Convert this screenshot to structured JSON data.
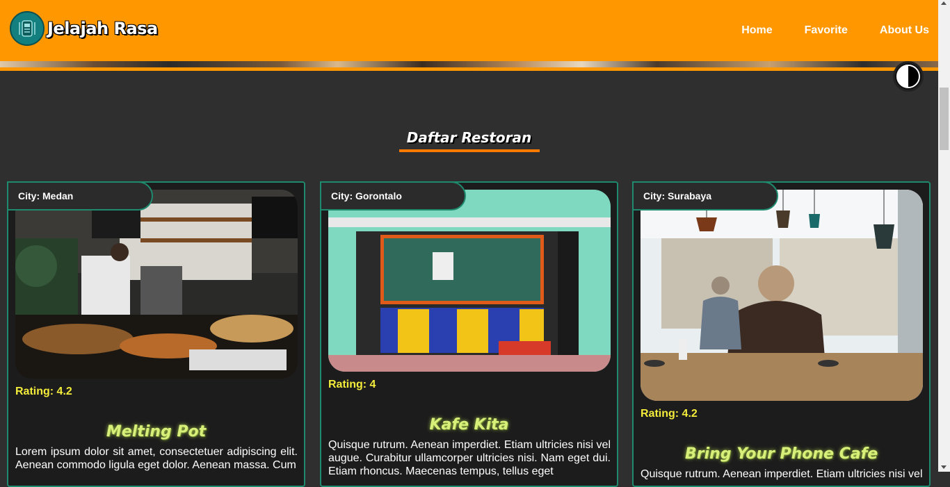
{
  "header": {
    "brand": "Jelajah Rasa",
    "nav": [
      "Home",
      "Favorite",
      "About Us"
    ]
  },
  "section": {
    "title": "Daftar Restoran"
  },
  "restaurants": [
    {
      "city": "City: Medan",
      "rating": "Rating: 4.2",
      "name": "Melting Pot",
      "description": "Lorem ipsum dolor sit amet, consectetuer adipiscing elit. Aenean commodo ligula eget dolor. Aenean massa. Cum"
    },
    {
      "city": "City: Gorontalo",
      "rating": "Rating: 4",
      "name": "Kafe Kita",
      "description": "Quisque rutrum. Aenean imperdiet. Etiam ultricies nisi vel augue. Curabitur ullamcorper ultricies nisi. Nam eget dui. Etiam rhoncus. Maecenas tempus, tellus eget"
    },
    {
      "city": "City: Surabaya",
      "rating": "Rating: 4.2",
      "name": "Bring Your Phone Cafe",
      "description": "Quisque rutrum. Aenean imperdiet. Etiam ultricies nisi vel"
    }
  ],
  "colors": {
    "header": "#ff9800",
    "background": "#2f2f2f",
    "card_border": "#1e8a6e",
    "rating": "#f4ec3a",
    "name": "#d8f07a"
  }
}
